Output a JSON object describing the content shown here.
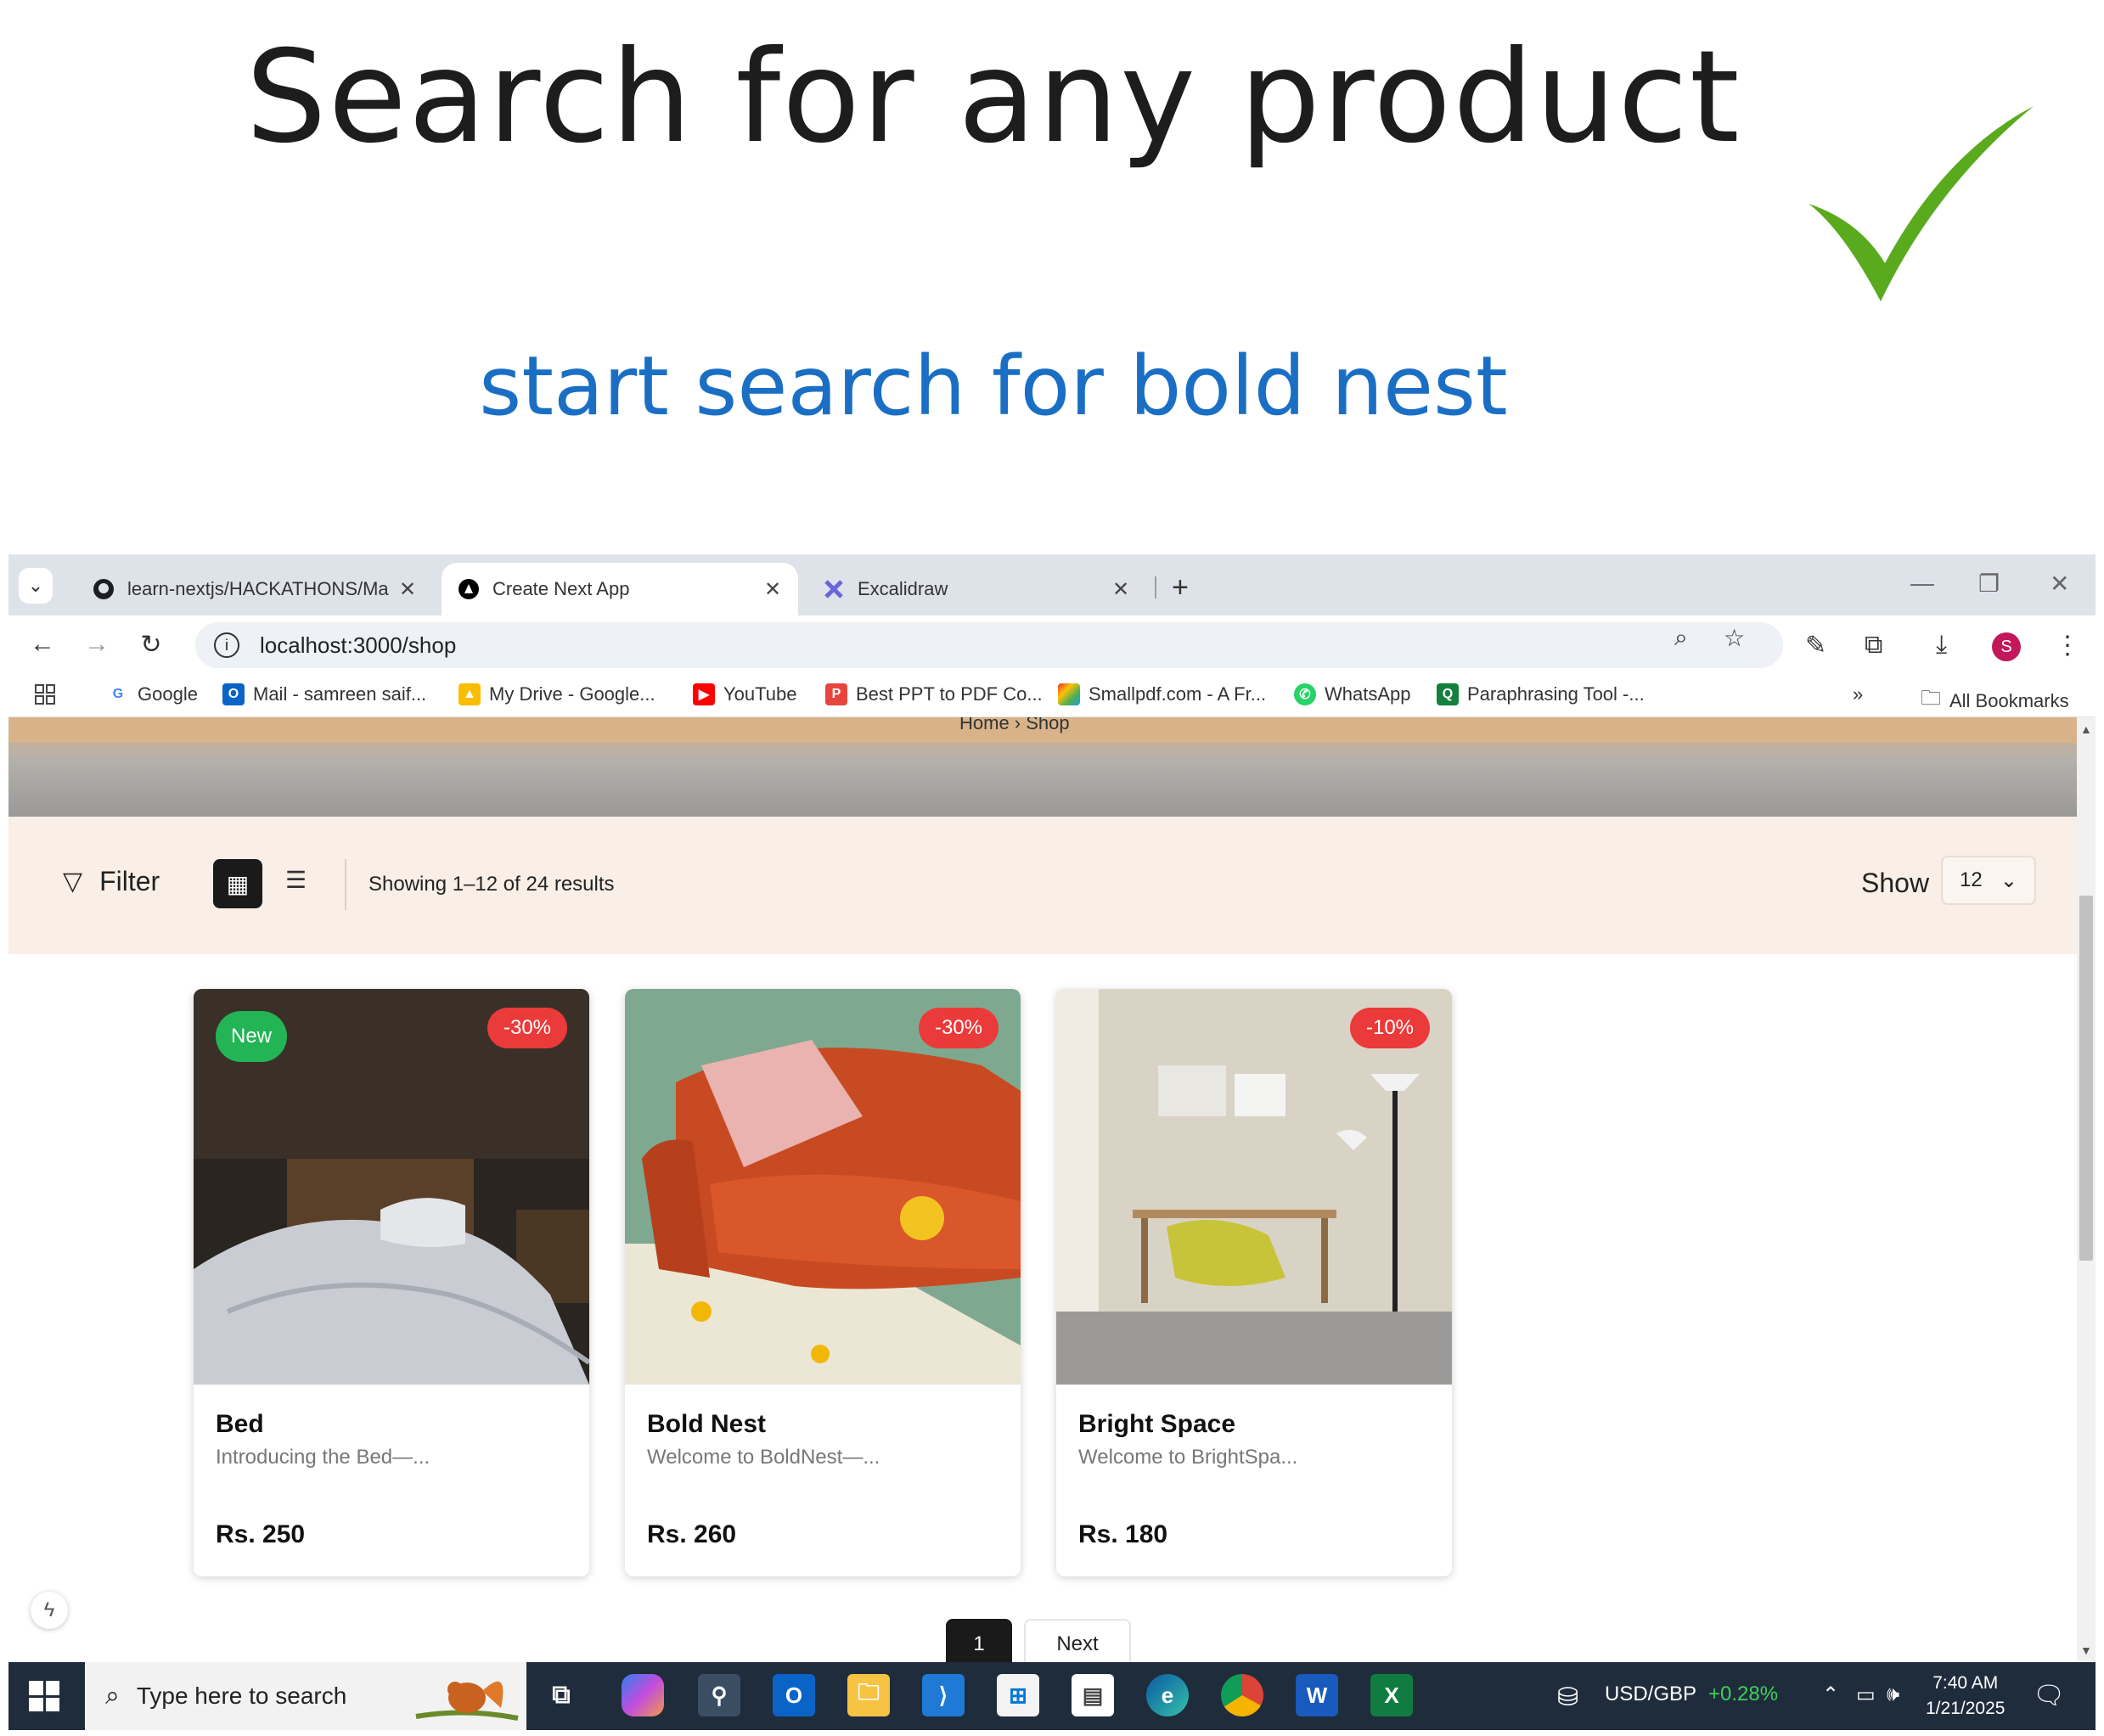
{
  "annotation": {
    "headline": "Search for any product",
    "subline": "start search for bold nest",
    "check_icon": "checkmark-icon",
    "colors": {
      "headline": "#1d1d1d",
      "subline": "#1a6fc4",
      "check": "#5aaa1e"
    }
  },
  "browser": {
    "tabs": [
      {
        "label": "learn-nextjs/HACKATHONS/Ma",
        "icon": "github-icon",
        "close": "✕"
      },
      {
        "label": "Create Next App",
        "icon": "nextjs-icon",
        "close": "✕"
      },
      {
        "label": "Excalidraw",
        "icon": "excalidraw-icon",
        "close": "✕"
      }
    ],
    "new_tab": "+",
    "url": "localhost:3000/shop",
    "bookmarks": [
      {
        "label": "Google",
        "icon": "google-icon"
      },
      {
        "label": "Mail - samreen saif...",
        "icon": "outlook-icon"
      },
      {
        "label": "My Drive - Google...",
        "icon": "drive-icon"
      },
      {
        "label": "YouTube",
        "icon": "youtube-icon"
      },
      {
        "label": "Best PPT to PDF Co...",
        "icon": "ppt-pdf-icon"
      },
      {
        "label": "Smallpdf.com - A Fr...",
        "icon": "smallpdf-icon"
      },
      {
        "label": "WhatsApp",
        "icon": "whatsapp-icon"
      },
      {
        "label": "Paraphrasing Tool -...",
        "icon": "paraphrase-icon"
      }
    ],
    "bookmarks_overflow": "»",
    "all_bookmarks": "All Bookmarks",
    "profile_initial": "S"
  },
  "page": {
    "breadcrumb": "Home  ›  Shop",
    "filter_label": "Filter",
    "results_text": "Showing 1–12 of 24 results",
    "show_label": "Show",
    "show_value": "12",
    "products": [
      {
        "name": "Bed",
        "description": "Introducing the Bed—...",
        "price": "Rs. 250",
        "badge_new": "New",
        "discount": "-30%"
      },
      {
        "name": "Bold Nest",
        "description": "Welcome to BoldNest—...",
        "price": "Rs. 260",
        "badge_new": "",
        "discount": "-30%"
      },
      {
        "name": "Bright Space",
        "description": "Welcome to BrightSpa...",
        "price": "Rs. 180",
        "badge_new": "",
        "discount": "-10%"
      }
    ],
    "pager": {
      "current": "1",
      "next": "Next"
    }
  },
  "taskbar": {
    "search_placeholder": "Type here to search",
    "currency": "USD/GBP",
    "currency_change": "+0.28%",
    "time": "7:40 AM",
    "date": "1/21/2025"
  }
}
